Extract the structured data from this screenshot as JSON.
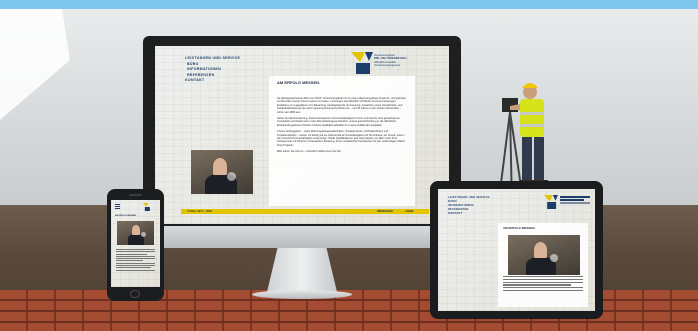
{
  "desktop": {
    "nav": [
      "LEISTUNGEN UND SERVICE",
      "BÜRO",
      "INFORMATIONEN",
      "REFERENZEN",
      "KONTAKT"
    ],
    "logo_text": [
      "Vermessungsbüro",
      "DIPL.-ING. RÜDIGER KOLL",
      "Öffentlich bestellter",
      "Vermessungsingenieur"
    ],
    "heading": "AM ERFOLG MESSEN.",
    "paragraphs": [
      "Als ältestgewachsenes Büro bei (ÖbVI) Vermessungsbüro ist es unser allgemeingültiger Anspruch, und jederzeit ein Resultat unserer Arbeit messen zu lassen. Leistungen wie öffentlich-rechtliche Grenzvermessungen, Erstellung von Lageplänen zum Bauantrag, bauabgleitende Vermessung, Gutachten sowie Grundstücks- und Gebäudeabsteckung wie auch ingenieurvermessung führen wir – seit 40 Jahren in der zweiten Generation – schon seit 1980 aus.",
      "Aktive Kundenorientierung, Kostentransparenz und Zuverlässigkeit in Form und Service sind gewachsenes Grundsätze und bestimmen unser Dienstleistungsverständnis, unsere gute Einbindung in die öffentliche Entscheidungsebenen fördern höchste Qualitätsmaßstäbe für unsere anfallenden Aufgaben.",
      "Unsere Auftraggeber – meist Wohnungsbaugesellschaften, Privatpersonen, Architekturbüros und Projektentwickler – setzen mit Erfolg auf ein Höchstmaß an Zuverlässigkeit und Termintreue; ein Grund, warum Sie schnell fünf Geschäftsjahre ansprechen. Beide Qualifikationen aus zwei Händen vor allem nach Ihrer Schwerpunkt mit Partnern umfassenden Beratung, ist ein verlässlicher Fachpartner für den notwendigen Ablauf Ihres Projekts.",
      "Bitte sehen Sie sich an – freundlich willkommen bei Sie!"
    ],
    "footer_left": "© KOLL 2017 – 2018",
    "footer_right": [
      "IMPRESSUM",
      "LOGIN"
    ]
  },
  "tablet": {
    "nav": [
      "LEISTUNGEN UND SERVICE",
      "BÜRO",
      "INFORMATIONEN",
      "REFERENZEN",
      "KONTAKT"
    ],
    "heading": "AM ERFOLG MESSEN."
  },
  "phone": {
    "heading": "AM ERFOLG MESSEN."
  },
  "colors": {
    "accent_yellow": "#e2c400",
    "navy": "#1d3d6a",
    "sky": "#7fc6ee"
  }
}
